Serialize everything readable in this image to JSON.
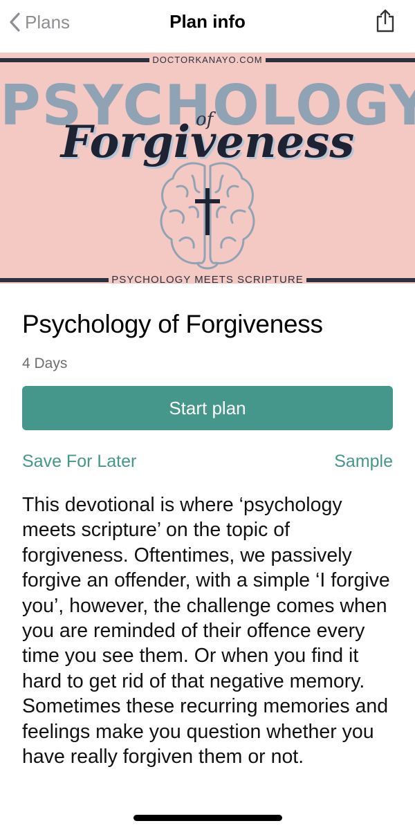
{
  "nav": {
    "back_label": "Plans",
    "title": "Plan info",
    "back_icon": "chevron-left-icon",
    "share_icon": "share-icon"
  },
  "banner": {
    "url": "DOCTORKANAYO.COM",
    "heading": "PSYCHOLOGY",
    "connector": "of",
    "script": "Forgiveness",
    "tagline": "PSYCHOLOGY MEETS SCRIPTURE",
    "colors": {
      "background": "#f4c8c3",
      "heading": "#8fa3b5",
      "dark": "#1d2333"
    }
  },
  "plan": {
    "title": "Psychology of Forgiveness",
    "duration": "4 Days",
    "start_label": "Start plan",
    "save_label": "Save For Later",
    "sample_label": "Sample",
    "description": "This devotional is where ‘psychology meets scripture’ on the topic of forgiveness. Oftentimes, we passively forgive an offender, with a simple ‘I forgive you’, however, the challenge comes when you are reminded of their offence every time you see them. Or when you find it hard to get rid of that negative memory. Sometimes these recurring memories and feelings make you question whether you have really forgiven them or not."
  },
  "colors": {
    "accent": "#44978a"
  }
}
